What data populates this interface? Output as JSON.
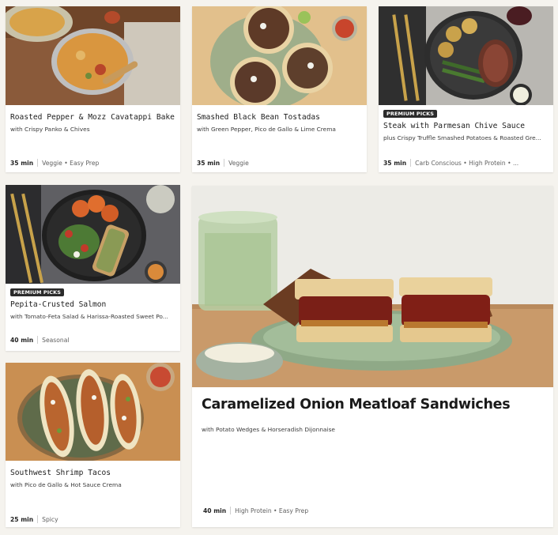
{
  "recipes": [
    {
      "title": "Roasted Pepper & Mozz Cavatappi Bake",
      "subtitle": "with Crispy Panko & Chives",
      "time": "35 min",
      "tags": "Veggie • Easy Prep",
      "badge": ""
    },
    {
      "title": "Smashed Black Bean Tostadas",
      "subtitle": "with Green Pepper, Pico de Gallo & Lime Crema",
      "time": "35 min",
      "tags": "Veggie",
      "badge": ""
    },
    {
      "title": "Steak with Parmesan Chive Sauce",
      "subtitle": "plus Crispy Truffle Smashed Potatoes & Roasted Gre...",
      "time": "35 min",
      "tags": "Carb Conscious • High Protein • ...",
      "badge": "PREMIUM PICKS"
    },
    {
      "title": "Pepita-Crusted Salmon",
      "subtitle": "with Tomato-Feta Salad & Harissa-Roasted Sweet Po...",
      "time": "40 min",
      "tags": "Seasonal",
      "badge": "PREMIUM PICKS"
    },
    {
      "title": "Caramelized Onion Meatloaf Sandwiches",
      "subtitle": "with Potato Wedges & Horseradish Dijonnaise",
      "time": "40 min",
      "tags": "High Protein • Easy Prep",
      "badge": ""
    },
    {
      "title": "Southwest Shrimp Tacos",
      "subtitle": "with Pico de Gallo & Hot Sauce Crema",
      "time": "25 min",
      "tags": "Spicy",
      "badge": ""
    }
  ]
}
